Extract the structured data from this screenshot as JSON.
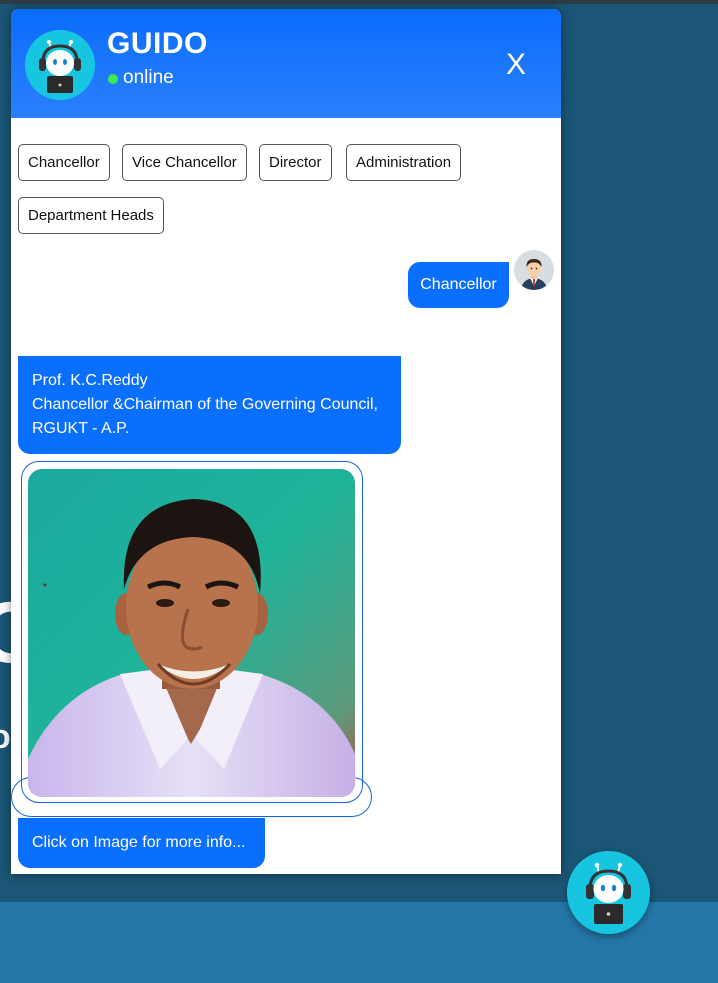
{
  "background": {
    "fragment_large": "G",
    "fragment_small": "o"
  },
  "header": {
    "title": "GUIDO",
    "status": "online",
    "close_label": "X"
  },
  "quick_replies": [
    "Chancellor",
    "Vice Chancellor",
    "Director",
    "Administration",
    "Department Heads"
  ],
  "messages": {
    "user_message": "Chancellor",
    "bot_reply": {
      "line1": "Prof. K.C.Reddy",
      "line2": "Chancellor &Chairman of the Governing Council,",
      "line3": "RGUKT - A.P."
    },
    "info_prompt": "Click on Image for more info..."
  },
  "icons": {
    "header_avatar": "robot-headset-icon",
    "user_avatar": "user-avatar-icon",
    "launcher": "chatbot-launcher-icon",
    "close": "close-icon"
  },
  "colors": {
    "header_blue": "#0a6cfd",
    "bubble_blue": "#0b6ffd",
    "online_green": "#3ee84f",
    "bot_teal": "#17c5e0",
    "page_background": "#1b5676"
  }
}
